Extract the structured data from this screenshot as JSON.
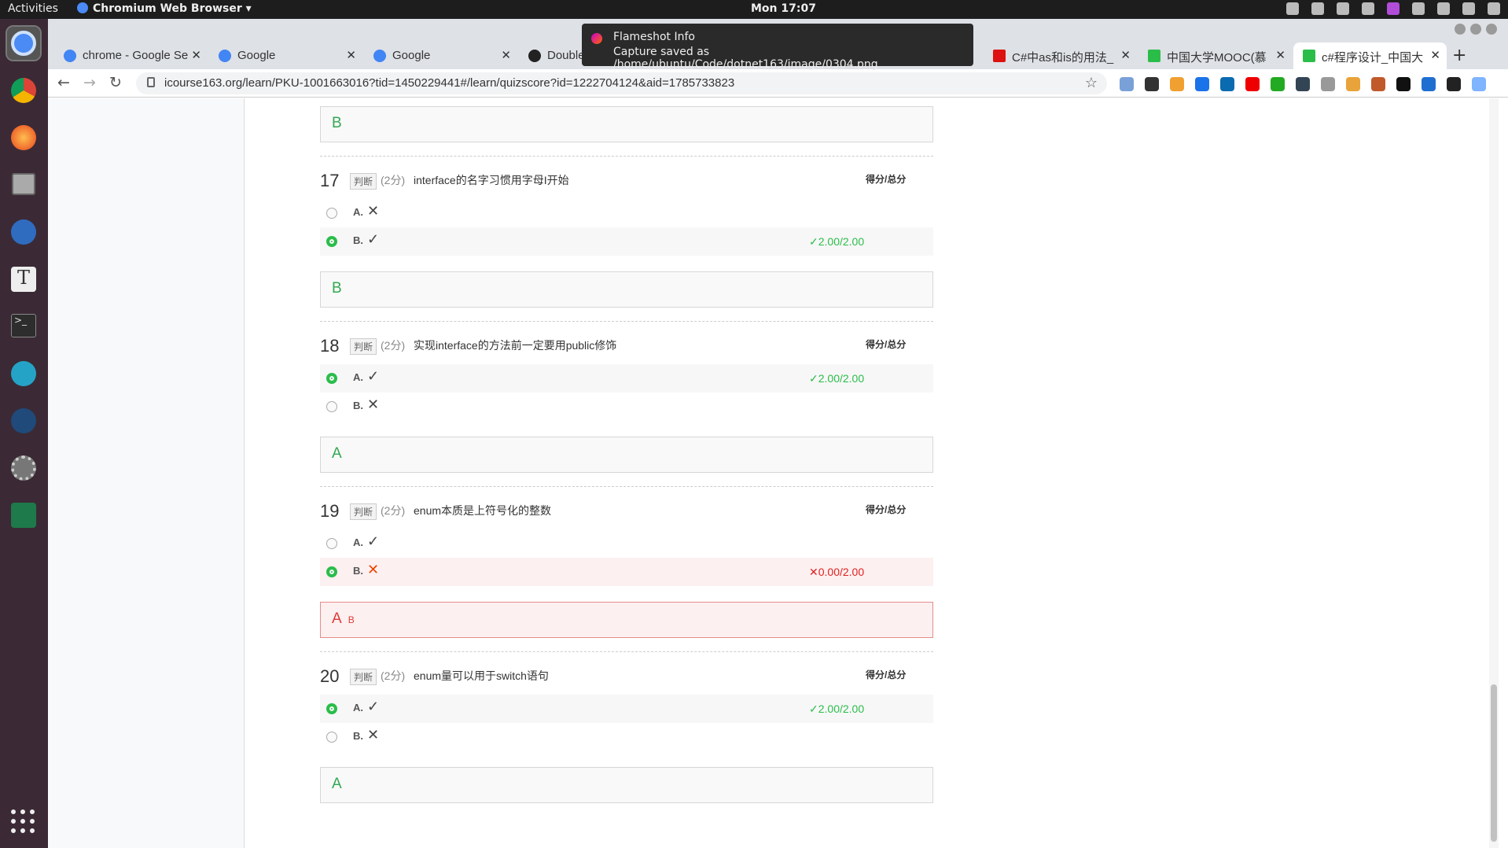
{
  "system": {
    "activities": "Activities",
    "app_name": "Chromium Web Browser ▾",
    "clock": "Mon 17:07"
  },
  "notification": {
    "title": "Flameshot Info",
    "message": "Capture saved as /home/ubuntu/Code/dotnet163/image/0304.png"
  },
  "tabs": [
    {
      "label": "chrome - Google Se"
    },
    {
      "label": "Google"
    },
    {
      "label": "Google"
    },
    {
      "label": "Double"
    },
    {
      "label": "C#中as和is的用法_"
    },
    {
      "label": "中国大学MOOC(慕"
    },
    {
      "label": "c#程序设计_中国大"
    }
  ],
  "tab_close": "✕",
  "new_tab": "+",
  "address_bar": {
    "url": "icourse163.org/learn/PKU-1001663016?tid=1450229441#/learn/quizscore?id=1222704124&aid=1785733823"
  },
  "quiz": {
    "score_label": "得分/总分",
    "top_answer": "B",
    "questions": [
      {
        "number": "17",
        "type": "判断",
        "points": "(2分)",
        "text": "interface的名字习惯用字母I开始",
        "options": [
          {
            "label": "A.",
            "mark": "✕"
          },
          {
            "label": "B.",
            "mark": "✓",
            "result": "✓2.00/2.00"
          }
        ],
        "answer": "B"
      },
      {
        "number": "18",
        "type": "判断",
        "points": "(2分)",
        "text": "实现interface的方法前一定要用public修饰",
        "options": [
          {
            "label": "A.",
            "mark": "✓",
            "result": "✓2.00/2.00"
          },
          {
            "label": "B.",
            "mark": "✕"
          }
        ],
        "answer": "A"
      },
      {
        "number": "19",
        "type": "判断",
        "points": "(2分)",
        "text": "enum本质是上符号化的整数",
        "options": [
          {
            "label": "A.",
            "mark": "✓"
          },
          {
            "label": "B.",
            "mark": "✕",
            "result": "✕0.00/2.00"
          }
        ],
        "answer": "A",
        "your_answer": "B"
      },
      {
        "number": "20",
        "type": "判断",
        "points": "(2分)",
        "text": "enum量可以用于switch语句",
        "options": [
          {
            "label": "A.",
            "mark": "✓",
            "result": "✓2.00/2.00"
          },
          {
            "label": "B.",
            "mark": "✕"
          }
        ],
        "answer": "A"
      }
    ]
  }
}
